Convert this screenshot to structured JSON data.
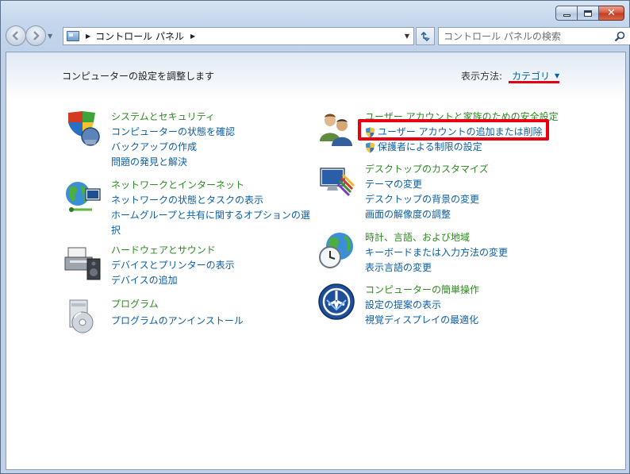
{
  "window": {
    "caption": {
      "minimize": "—",
      "maximize": "□",
      "close": "✕"
    }
  },
  "navbar": {
    "back_icon": "back-arrow-icon",
    "forward_icon": "forward-arrow-icon",
    "breadcrumb": "コントロール パネル",
    "search_placeholder": "コントロール パネルの検索"
  },
  "main": {
    "heading": "コンピューターの設定を調整します",
    "view_by_label": "表示方法:",
    "view_by_value": "カテゴリ"
  },
  "categories": [
    {
      "icon": "system-security-icon",
      "title": "システムとセキュリティ",
      "links": [
        "コンピューターの状態を確認",
        "バックアップの作成",
        "問題の発見と解決"
      ]
    },
    {
      "icon": "network-internet-icon",
      "title": "ネットワークとインターネット",
      "links": [
        "ネットワークの状態とタスクの表示",
        "ホームグループと共有に関するオプションの選択"
      ]
    },
    {
      "icon": "hardware-sound-icon",
      "title": "ハードウェアとサウンド",
      "links": [
        "デバイスとプリンターの表示",
        "デバイスの追加"
      ]
    },
    {
      "icon": "programs-icon",
      "title": "プログラム",
      "links": [
        "プログラムのアンインストール"
      ]
    },
    {
      "icon": "user-accounts-icon",
      "title": "ユーザー アカウントと家族のための安全設定",
      "links": [
        "ユーザー アカウントの追加または削除",
        "保護者による制限の設定"
      ]
    },
    {
      "icon": "appearance-icon",
      "title": "デスクトップのカスタマイズ",
      "links": [
        "テーマの変更",
        "デスクトップの背景の変更",
        "画面の解像度の調整"
      ]
    },
    {
      "icon": "clock-region-icon",
      "title": "時計、言語、および地域",
      "links": [
        "キーボードまたは入力方法の変更",
        "表示言語の変更"
      ]
    },
    {
      "icon": "ease-of-access-icon",
      "title": "コンピューターの簡単操作",
      "links": [
        "設定の提案の表示",
        "視覚ディスプレイの最適化"
      ]
    }
  ],
  "colors": {
    "link": "#0b5fa5",
    "category_title": "#2b8a1f",
    "highlight": "#e60012"
  }
}
